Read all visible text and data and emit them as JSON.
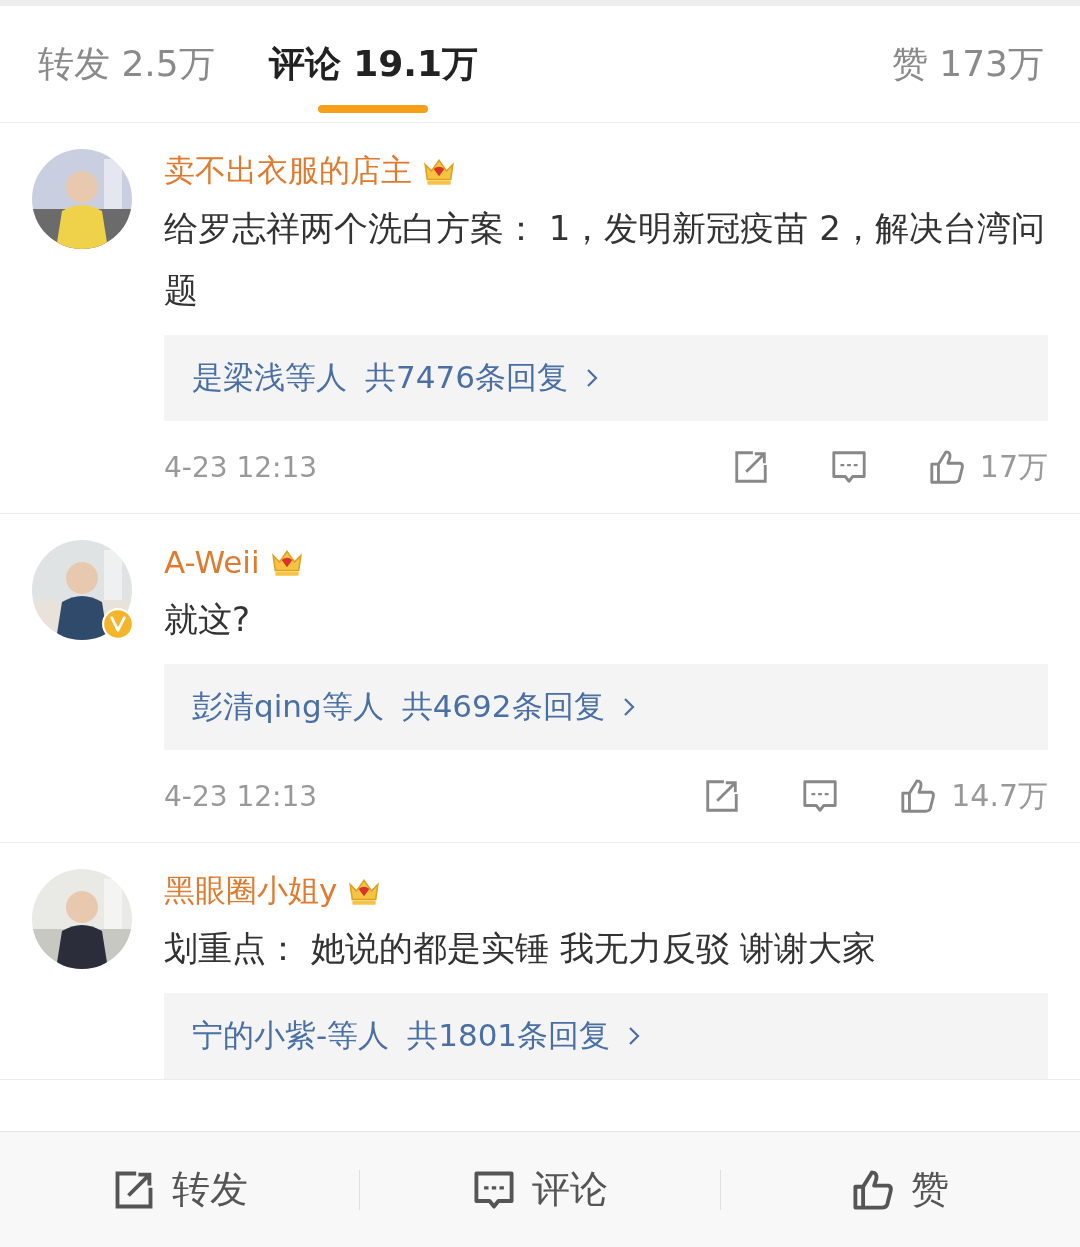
{
  "tabs": [
    {
      "label": "转发 2.5万",
      "selected": false
    },
    {
      "label": "评论 19.1万",
      "selected": true
    },
    {
      "label": "赞 173万",
      "selected": false
    }
  ],
  "comments": [
    {
      "name": "卖不出衣服的店主",
      "verified": false,
      "text": "给罗志祥两个洗白方案： 1，发明新冠疫苗 2，解决台湾问题",
      "replies_by": "是梁浅等人",
      "replies_count": "共7476条回复",
      "time": "4-23 12:13",
      "likes": "17万"
    },
    {
      "name": "A-Weii",
      "verified": true,
      "text": "就这?",
      "replies_by": "彭清qing等人",
      "replies_count": "共4692条回复",
      "time": "4-23 12:13",
      "likes": "14.7万"
    },
    {
      "name": "黑眼圈小姐y",
      "verified": false,
      "text": "划重点： 她说的都是实锤 我无力反驳 谢谢大家",
      "replies_by": "宁的小紫-等人",
      "replies_count": "共1801条回复"
    }
  ],
  "bottom_bar": [
    {
      "kind": "repost",
      "label": "转发"
    },
    {
      "kind": "comment",
      "label": "评论"
    },
    {
      "kind": "like",
      "label": "赞"
    }
  ]
}
